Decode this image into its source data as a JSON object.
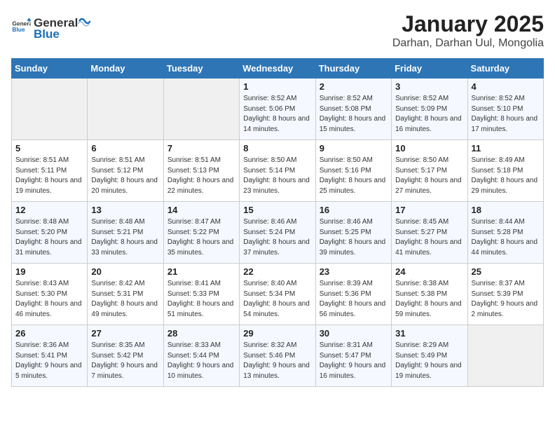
{
  "header": {
    "logo_general": "General",
    "logo_blue": "Blue",
    "title": "January 2025",
    "subtitle": "Darhan, Darhan Uul, Mongolia"
  },
  "days_of_week": [
    "Sunday",
    "Monday",
    "Tuesday",
    "Wednesday",
    "Thursday",
    "Friday",
    "Saturday"
  ],
  "weeks": [
    [
      {
        "day": "",
        "empty": true
      },
      {
        "day": "",
        "empty": true
      },
      {
        "day": "",
        "empty": true
      },
      {
        "day": "1",
        "sunrise": "8:52 AM",
        "sunset": "5:06 PM",
        "daylight": "8 hours and 14 minutes."
      },
      {
        "day": "2",
        "sunrise": "8:52 AM",
        "sunset": "5:08 PM",
        "daylight": "8 hours and 15 minutes."
      },
      {
        "day": "3",
        "sunrise": "8:52 AM",
        "sunset": "5:09 PM",
        "daylight": "8 hours and 16 minutes."
      },
      {
        "day": "4",
        "sunrise": "8:52 AM",
        "sunset": "5:10 PM",
        "daylight": "8 hours and 17 minutes."
      }
    ],
    [
      {
        "day": "5",
        "sunrise": "8:51 AM",
        "sunset": "5:11 PM",
        "daylight": "8 hours and 19 minutes."
      },
      {
        "day": "6",
        "sunrise": "8:51 AM",
        "sunset": "5:12 PM",
        "daylight": "8 hours and 20 minutes."
      },
      {
        "day": "7",
        "sunrise": "8:51 AM",
        "sunset": "5:13 PM",
        "daylight": "8 hours and 22 minutes."
      },
      {
        "day": "8",
        "sunrise": "8:50 AM",
        "sunset": "5:14 PM",
        "daylight": "8 hours and 23 minutes."
      },
      {
        "day": "9",
        "sunrise": "8:50 AM",
        "sunset": "5:16 PM",
        "daylight": "8 hours and 25 minutes."
      },
      {
        "day": "10",
        "sunrise": "8:50 AM",
        "sunset": "5:17 PM",
        "daylight": "8 hours and 27 minutes."
      },
      {
        "day": "11",
        "sunrise": "8:49 AM",
        "sunset": "5:18 PM",
        "daylight": "8 hours and 29 minutes."
      }
    ],
    [
      {
        "day": "12",
        "sunrise": "8:48 AM",
        "sunset": "5:20 PM",
        "daylight": "8 hours and 31 minutes."
      },
      {
        "day": "13",
        "sunrise": "8:48 AM",
        "sunset": "5:21 PM",
        "daylight": "8 hours and 33 minutes."
      },
      {
        "day": "14",
        "sunrise": "8:47 AM",
        "sunset": "5:22 PM",
        "daylight": "8 hours and 35 minutes."
      },
      {
        "day": "15",
        "sunrise": "8:46 AM",
        "sunset": "5:24 PM",
        "daylight": "8 hours and 37 minutes."
      },
      {
        "day": "16",
        "sunrise": "8:46 AM",
        "sunset": "5:25 PM",
        "daylight": "8 hours and 39 minutes."
      },
      {
        "day": "17",
        "sunrise": "8:45 AM",
        "sunset": "5:27 PM",
        "daylight": "8 hours and 41 minutes."
      },
      {
        "day": "18",
        "sunrise": "8:44 AM",
        "sunset": "5:28 PM",
        "daylight": "8 hours and 44 minutes."
      }
    ],
    [
      {
        "day": "19",
        "sunrise": "8:43 AM",
        "sunset": "5:30 PM",
        "daylight": "8 hours and 46 minutes."
      },
      {
        "day": "20",
        "sunrise": "8:42 AM",
        "sunset": "5:31 PM",
        "daylight": "8 hours and 49 minutes."
      },
      {
        "day": "21",
        "sunrise": "8:41 AM",
        "sunset": "5:33 PM",
        "daylight": "8 hours and 51 minutes."
      },
      {
        "day": "22",
        "sunrise": "8:40 AM",
        "sunset": "5:34 PM",
        "daylight": "8 hours and 54 minutes."
      },
      {
        "day": "23",
        "sunrise": "8:39 AM",
        "sunset": "5:36 PM",
        "daylight": "8 hours and 56 minutes."
      },
      {
        "day": "24",
        "sunrise": "8:38 AM",
        "sunset": "5:38 PM",
        "daylight": "8 hours and 59 minutes."
      },
      {
        "day": "25",
        "sunrise": "8:37 AM",
        "sunset": "5:39 PM",
        "daylight": "9 hours and 2 minutes."
      }
    ],
    [
      {
        "day": "26",
        "sunrise": "8:36 AM",
        "sunset": "5:41 PM",
        "daylight": "9 hours and 5 minutes."
      },
      {
        "day": "27",
        "sunrise": "8:35 AM",
        "sunset": "5:42 PM",
        "daylight": "9 hours and 7 minutes."
      },
      {
        "day": "28",
        "sunrise": "8:33 AM",
        "sunset": "5:44 PM",
        "daylight": "9 hours and 10 minutes."
      },
      {
        "day": "29",
        "sunrise": "8:32 AM",
        "sunset": "5:46 PM",
        "daylight": "9 hours and 13 minutes."
      },
      {
        "day": "30",
        "sunrise": "8:31 AM",
        "sunset": "5:47 PM",
        "daylight": "9 hours and 16 minutes."
      },
      {
        "day": "31",
        "sunrise": "8:29 AM",
        "sunset": "5:49 PM",
        "daylight": "9 hours and 19 minutes."
      },
      {
        "day": "",
        "empty": true
      }
    ]
  ],
  "labels": {
    "sunrise": "Sunrise:",
    "sunset": "Sunset:",
    "daylight": "Daylight:"
  }
}
